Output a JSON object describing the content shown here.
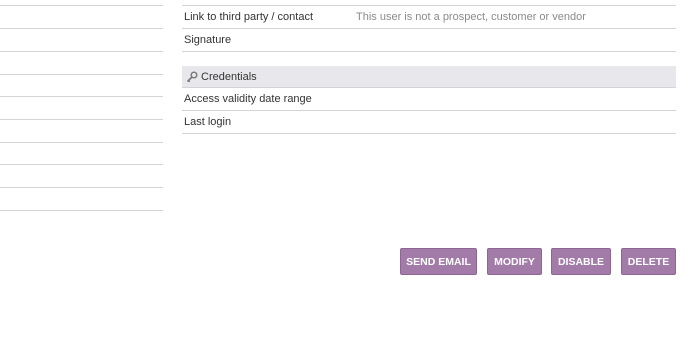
{
  "fields": [
    {
      "label": "Link to third party / contact",
      "value": "This user is not a prospect, customer or vendor"
    },
    {
      "label": "Signature",
      "value": ""
    }
  ],
  "credentials": {
    "title": "Credentials",
    "icon": "key-icon",
    "rows": [
      {
        "label": "Access validity date range",
        "value": ""
      },
      {
        "label": "Last login",
        "value": ""
      }
    ]
  },
  "actions": {
    "send_email": "SEND EMAIL",
    "modify": "MODIFY",
    "disable": "DISABLE",
    "delete": "DELETE"
  },
  "colors": {
    "button_bg": "#a27ba8",
    "header_bg": "#e8e8ec"
  }
}
